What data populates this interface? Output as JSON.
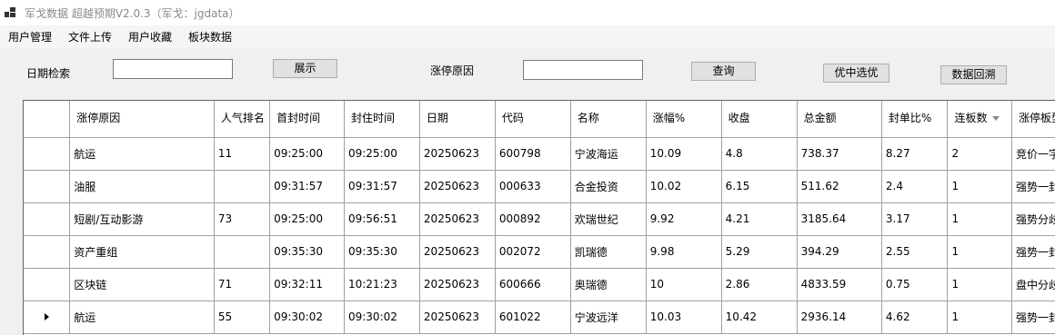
{
  "window": {
    "title": "军戈数据 超越预期V2.0.3（军戈：jgdata）"
  },
  "menu": [
    "用户管理",
    "文件上传",
    "用户收藏",
    "板块数据"
  ],
  "toolbar": {
    "date_label": "日期检索",
    "date_value": "",
    "show_button": "展示",
    "reason_label": "涨停原因",
    "reason_value": "",
    "query_button": "查询",
    "select_button": "优中选优",
    "backtrack_button": "数据回溯"
  },
  "table": {
    "headers": [
      "涨停原因",
      "人气排名",
      "首封时间",
      "封住时间",
      "日期",
      "代码",
      "名称",
      "涨幅%",
      "收盘",
      "总金额",
      "封单比%",
      "连板数",
      "涨停板型"
    ],
    "rows": [
      [
        "航运",
        "11",
        "09:25:00",
        "09:25:00",
        "20250623",
        "600798",
        "宁波海运",
        "10.09",
        "4.8",
        "738.37",
        "8.27",
        "2",
        "竞价一字"
      ],
      [
        "油服",
        "",
        "09:31:57",
        "09:31:57",
        "20250623",
        "000633",
        "合金投资",
        "10.02",
        "6.15",
        "511.62",
        "2.4",
        "1",
        "强势一封"
      ],
      [
        "短剧/互动影游",
        "73",
        "09:25:00",
        "09:56:51",
        "20250623",
        "000892",
        "欢瑞世纪",
        "9.92",
        "4.21",
        "3185.64",
        "3.17",
        "1",
        "强势分歧"
      ],
      [
        "资产重组",
        "",
        "09:35:30",
        "09:35:30",
        "20250623",
        "002072",
        "凯瑞德",
        "9.98",
        "5.29",
        "394.29",
        "2.55",
        "1",
        "强势一封"
      ],
      [
        "区块链",
        "71",
        "09:32:11",
        "10:21:23",
        "20250623",
        "600666",
        "奥瑞德",
        "10",
        "2.86",
        "4833.59",
        "0.75",
        "1",
        "盘中分歧"
      ],
      [
        "航运",
        "55",
        "09:30:02",
        "09:30:02",
        "20250623",
        "601022",
        "宁波远洋",
        "10.03",
        "10.42",
        "2936.14",
        "4.62",
        "1",
        "强势一封"
      ]
    ],
    "current_row": 5,
    "sorted_column": 11
  }
}
